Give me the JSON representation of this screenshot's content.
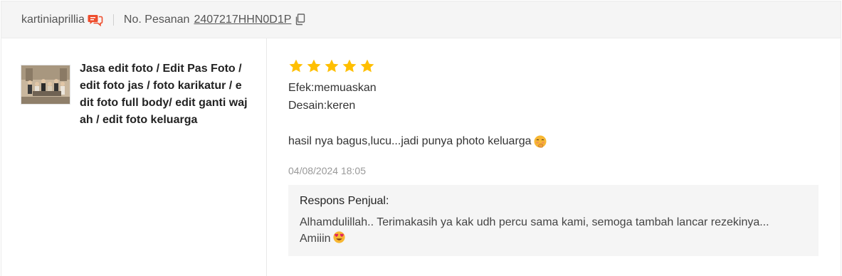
{
  "header": {
    "buyer_name": "kartiniaprillia",
    "order_label": "No. Pesanan",
    "order_number": "2407217HHN0D1P"
  },
  "product": {
    "title": "Jasa edit foto / Edit Pas Foto / edit foto jas / foto karikatur / edit foto full body/ edit ganti wajah / edit foto keluarga"
  },
  "review": {
    "rating": 5,
    "attributes": [
      {
        "label": "Efek",
        "value": "memuaskan",
        "text": "Efek:memuaskan"
      },
      {
        "label": "Desain",
        "value": "keren",
        "text": "Desain:keren"
      }
    ],
    "comment": "hasil nya bagus,lucu...jadi punya photo keluarga",
    "comment_emoji": "blushing-hand-over-mouth-emoji",
    "timestamp": "04/08/2024 18:05"
  },
  "seller_response": {
    "title": "Respons Penjual:",
    "text": "Alhamdulillah.. Terimakasih ya kak udh percu sama kami, semoga tambah lancar rezekinya... Amiiin",
    "emoji": "heart-eyes-emoji"
  },
  "colors": {
    "star": "#ffbf00",
    "chat_icon": "#ee4d2d",
    "header_bg": "#f5f5f5",
    "response_bg": "#f5f5f5"
  }
}
